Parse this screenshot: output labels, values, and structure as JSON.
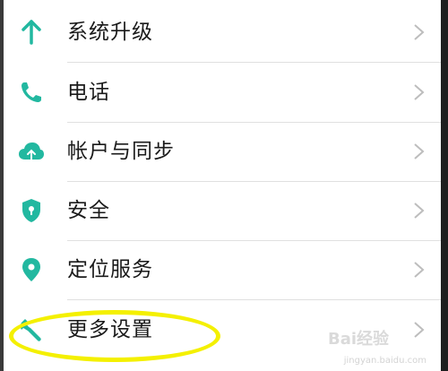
{
  "settings": {
    "items": [
      {
        "label": "系统升级",
        "icon": "arrow-up-icon"
      },
      {
        "label": "电话",
        "icon": "phone-icon"
      },
      {
        "label": "帐户与同步",
        "icon": "cloud-sync-icon"
      },
      {
        "label": "安全",
        "icon": "shield-icon"
      },
      {
        "label": "定位服务",
        "icon": "location-pin-icon"
      },
      {
        "label": "更多设置",
        "icon": "wrench-icon"
      }
    ]
  },
  "watermark": {
    "text": "Bai经验",
    "sub": "jingyan.baidu.com"
  },
  "colors": {
    "accent": "#22b8a0",
    "highlight": "#f4f000",
    "chevron": "#bdbdbd"
  }
}
